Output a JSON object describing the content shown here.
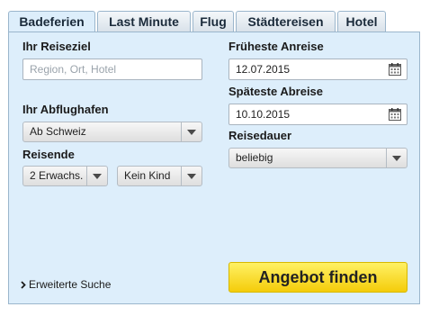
{
  "tabs": [
    {
      "label": "Badeferien",
      "active": true
    },
    {
      "label": "Last Minute",
      "active": false
    },
    {
      "label": "Flug",
      "active": false
    },
    {
      "label": "Städtereisen",
      "active": false
    },
    {
      "label": "Hotel",
      "active": false
    }
  ],
  "form": {
    "destination_label": "Ihr Reiseziel",
    "destination_placeholder": "Region, Ort, Hotel",
    "airport_label": "Ihr Abflughafen",
    "airport_value": "Ab Schweiz",
    "travelers_label": "Reisende",
    "adults_value": "2 Erwachs.",
    "children_value": "Kein Kind",
    "earliest_label": "Früheste Anreise",
    "earliest_value": "12.07.2015",
    "latest_label": "Späteste Abreise",
    "latest_value": "10.10.2015",
    "duration_label": "Reisedauer",
    "duration_value": "beliebig",
    "advanced_search_label": "Erweiterte Suche",
    "submit_label": "Angebot finden"
  },
  "icons": {
    "calendar": "calendar-icon",
    "dropdown": "chevron-down-icon",
    "link_arrow": "chevron-right-icon"
  },
  "colors": {
    "panel_bg": "#ddeefb",
    "cta_yellow": "#f4cc0a"
  }
}
